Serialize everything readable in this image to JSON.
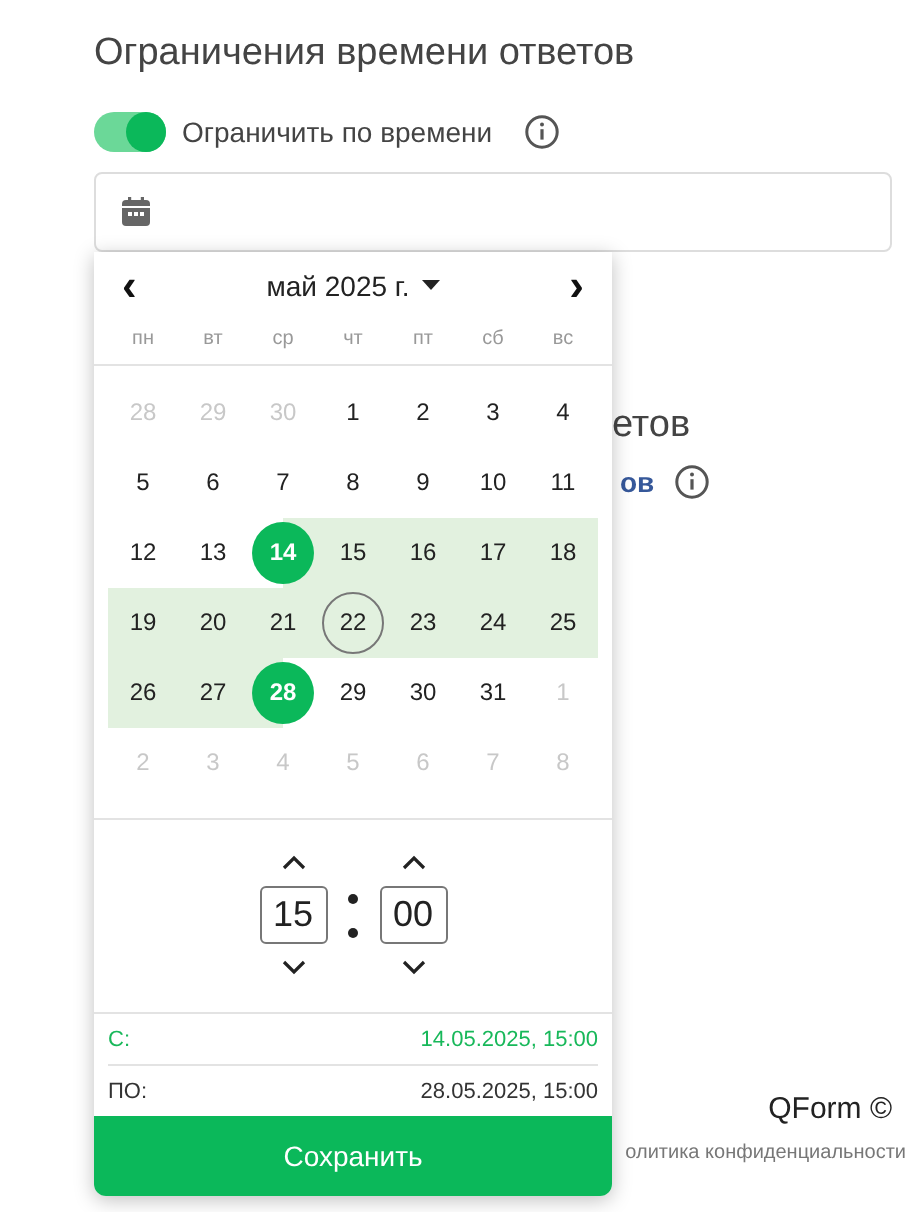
{
  "section": {
    "title": "Ограничения времени ответов",
    "toggle": {
      "label": "Ограничить по времени",
      "on": true
    }
  },
  "hidden_section": {
    "title_fragment": "етов",
    "label_fragment": "ов"
  },
  "calendar": {
    "prev": "‹",
    "next": "›",
    "month_label": "май 2025 г.",
    "weekdays": [
      "пн",
      "вт",
      "ср",
      "чт",
      "пт",
      "сб",
      "вс"
    ],
    "days": [
      {
        "text": "28",
        "outside": true,
        "selected": false,
        "in_range": false,
        "today": false
      },
      {
        "text": "29",
        "outside": true,
        "selected": false,
        "in_range": false,
        "today": false
      },
      {
        "text": "30",
        "outside": true,
        "selected": false,
        "in_range": false,
        "today": false
      },
      {
        "text": "1",
        "outside": false,
        "selected": false,
        "in_range": false,
        "today": false
      },
      {
        "text": "2",
        "outside": false,
        "selected": false,
        "in_range": false,
        "today": false
      },
      {
        "text": "3",
        "outside": false,
        "selected": false,
        "in_range": false,
        "today": false
      },
      {
        "text": "4",
        "outside": false,
        "selected": false,
        "in_range": false,
        "today": false
      },
      {
        "text": "5",
        "outside": false,
        "selected": false,
        "in_range": false,
        "today": false
      },
      {
        "text": "6",
        "outside": false,
        "selected": false,
        "in_range": false,
        "today": false
      },
      {
        "text": "7",
        "outside": false,
        "selected": false,
        "in_range": false,
        "today": false
      },
      {
        "text": "8",
        "outside": false,
        "selected": false,
        "in_range": false,
        "today": false
      },
      {
        "text": "9",
        "outside": false,
        "selected": false,
        "in_range": false,
        "today": false
      },
      {
        "text": "10",
        "outside": false,
        "selected": false,
        "in_range": false,
        "today": false
      },
      {
        "text": "11",
        "outside": false,
        "selected": false,
        "in_range": false,
        "today": false
      },
      {
        "text": "12",
        "outside": false,
        "selected": false,
        "in_range": false,
        "today": false
      },
      {
        "text": "13",
        "outside": false,
        "selected": false,
        "in_range": false,
        "today": false
      },
      {
        "text": "14",
        "outside": false,
        "selected": true,
        "in_range": false,
        "today": false
      },
      {
        "text": "15",
        "outside": false,
        "selected": false,
        "in_range": true,
        "today": false
      },
      {
        "text": "16",
        "outside": false,
        "selected": false,
        "in_range": true,
        "today": false
      },
      {
        "text": "17",
        "outside": false,
        "selected": false,
        "in_range": true,
        "today": false
      },
      {
        "text": "18",
        "outside": false,
        "selected": false,
        "in_range": true,
        "today": false
      },
      {
        "text": "19",
        "outside": false,
        "selected": false,
        "in_range": true,
        "today": false
      },
      {
        "text": "20",
        "outside": false,
        "selected": false,
        "in_range": true,
        "today": false
      },
      {
        "text": "21",
        "outside": false,
        "selected": false,
        "in_range": true,
        "today": false
      },
      {
        "text": "22",
        "outside": false,
        "selected": false,
        "in_range": true,
        "today": true
      },
      {
        "text": "23",
        "outside": false,
        "selected": false,
        "in_range": true,
        "today": false
      },
      {
        "text": "24",
        "outside": false,
        "selected": false,
        "in_range": true,
        "today": false
      },
      {
        "text": "25",
        "outside": false,
        "selected": false,
        "in_range": true,
        "today": false
      },
      {
        "text": "26",
        "outside": false,
        "selected": false,
        "in_range": true,
        "today": false
      },
      {
        "text": "27",
        "outside": false,
        "selected": false,
        "in_range": true,
        "today": false
      },
      {
        "text": "28",
        "outside": false,
        "selected": true,
        "in_range": false,
        "today": false
      },
      {
        "text": "29",
        "outside": false,
        "selected": false,
        "in_range": false,
        "today": false
      },
      {
        "text": "30",
        "outside": false,
        "selected": false,
        "in_range": false,
        "today": false
      },
      {
        "text": "31",
        "outside": false,
        "selected": false,
        "in_range": false,
        "today": false
      },
      {
        "text": "1",
        "outside": true,
        "selected": false,
        "in_range": false,
        "today": false
      },
      {
        "text": "2",
        "outside": true,
        "selected": false,
        "in_range": false,
        "today": false
      },
      {
        "text": "3",
        "outside": true,
        "selected": false,
        "in_range": false,
        "today": false
      },
      {
        "text": "4",
        "outside": true,
        "selected": false,
        "in_range": false,
        "today": false
      },
      {
        "text": "5",
        "outside": true,
        "selected": false,
        "in_range": false,
        "today": false
      },
      {
        "text": "6",
        "outside": true,
        "selected": false,
        "in_range": false,
        "today": false
      },
      {
        "text": "7",
        "outside": true,
        "selected": false,
        "in_range": false,
        "today": false
      },
      {
        "text": "8",
        "outside": true,
        "selected": false,
        "in_range": false,
        "today": false
      }
    ],
    "time": {
      "hours": "15",
      "minutes": "00"
    },
    "range": [
      {
        "label": "С:",
        "value": "14.05.2025, 15:00",
        "active": true
      },
      {
        "label": "ПО:",
        "value": "28.05.2025, 15:00",
        "active": false
      }
    ],
    "save": "Сохранить"
  },
  "footer": {
    "brand": "QForm ©",
    "privacy_fragment": "олитика конфиденциальности"
  }
}
